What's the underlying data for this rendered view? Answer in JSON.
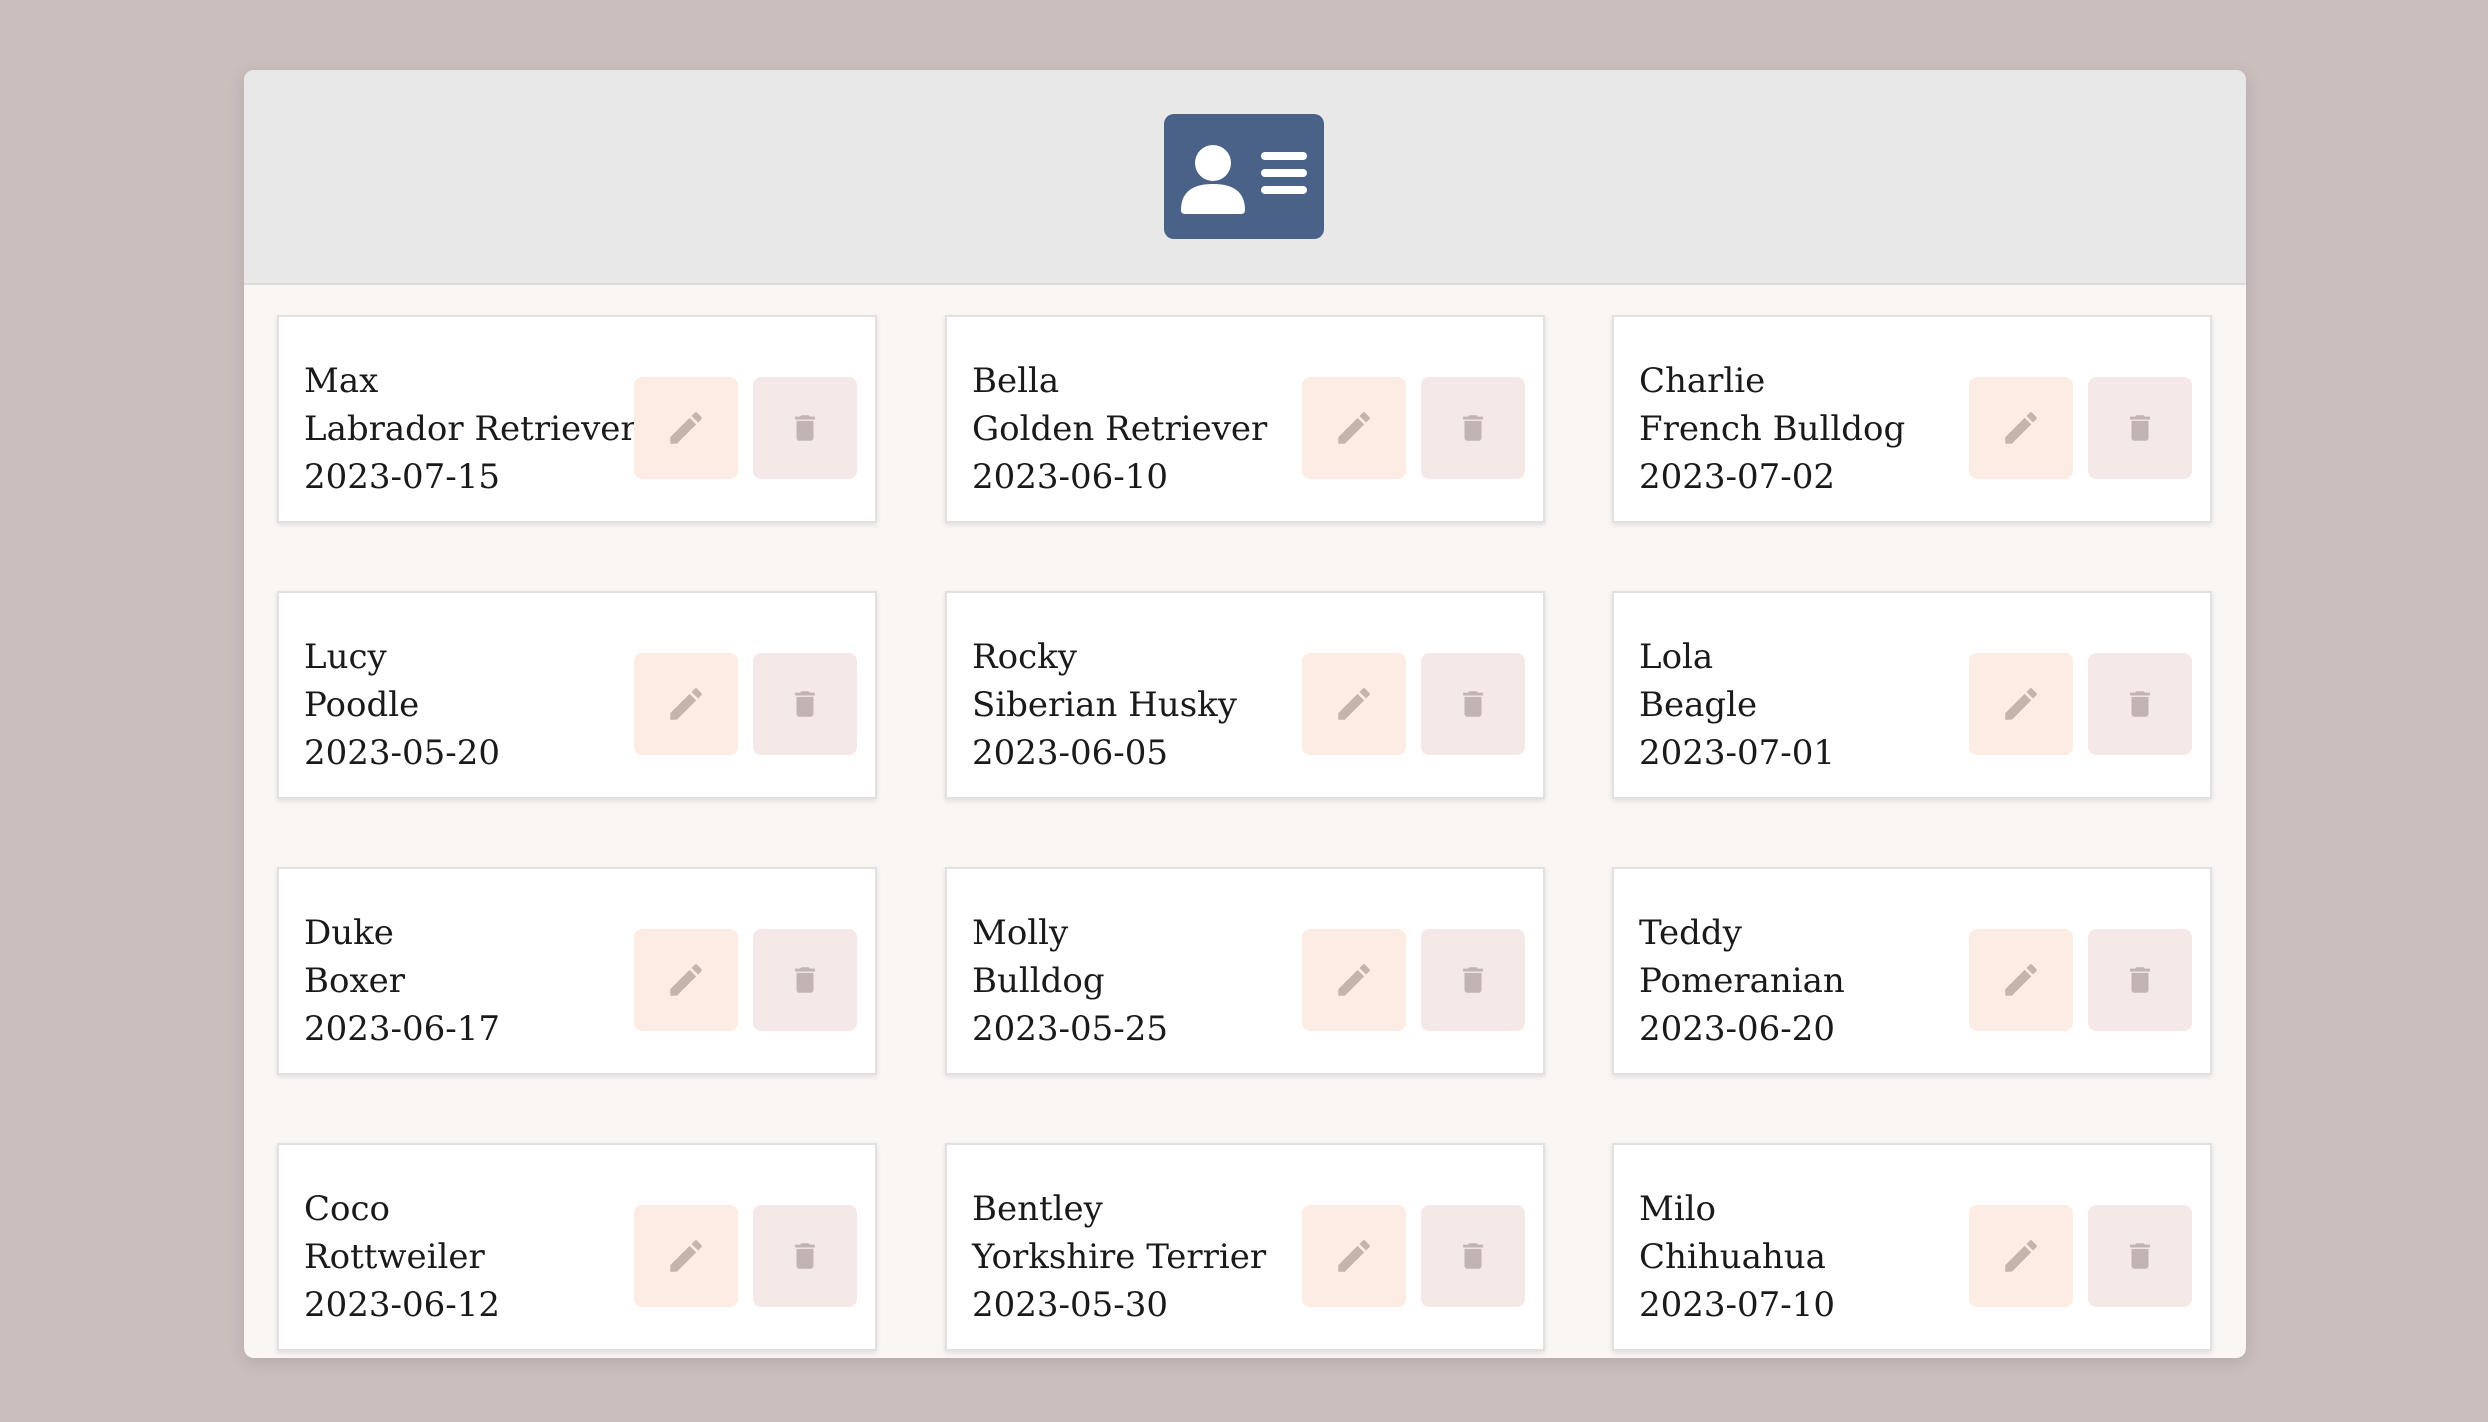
{
  "header": {
    "logo_icon": "id-card-icon",
    "logo_color": "#4a6188"
  },
  "actions": {
    "edit_icon": "pencil-icon",
    "delete_icon": "trash-icon",
    "edit_bg": "#fcece3",
    "delete_bg": "#f5e9e7"
  },
  "dogs": [
    {
      "name": "Max",
      "breed": "Labrador Retriever",
      "date": "2023-07-15"
    },
    {
      "name": "Bella",
      "breed": "Golden Retriever",
      "date": "2023-06-10"
    },
    {
      "name": "Charlie",
      "breed": "French Bulldog",
      "date": "2023-07-02"
    },
    {
      "name": "Lucy",
      "breed": "Poodle",
      "date": "2023-05-20"
    },
    {
      "name": "Rocky",
      "breed": "Siberian Husky",
      "date": "2023-06-05"
    },
    {
      "name": "Lola",
      "breed": "Beagle",
      "date": "2023-07-01"
    },
    {
      "name": "Duke",
      "breed": "Boxer",
      "date": "2023-06-17"
    },
    {
      "name": "Molly",
      "breed": "Bulldog",
      "date": "2023-05-25"
    },
    {
      "name": "Teddy",
      "breed": "Pomeranian",
      "date": "2023-06-20"
    },
    {
      "name": "Coco",
      "breed": "Rottweiler",
      "date": "2023-06-12"
    },
    {
      "name": "Bentley",
      "breed": "Yorkshire Terrier",
      "date": "2023-05-30"
    },
    {
      "name": "Milo",
      "breed": "Chihuahua",
      "date": "2023-07-10"
    }
  ]
}
